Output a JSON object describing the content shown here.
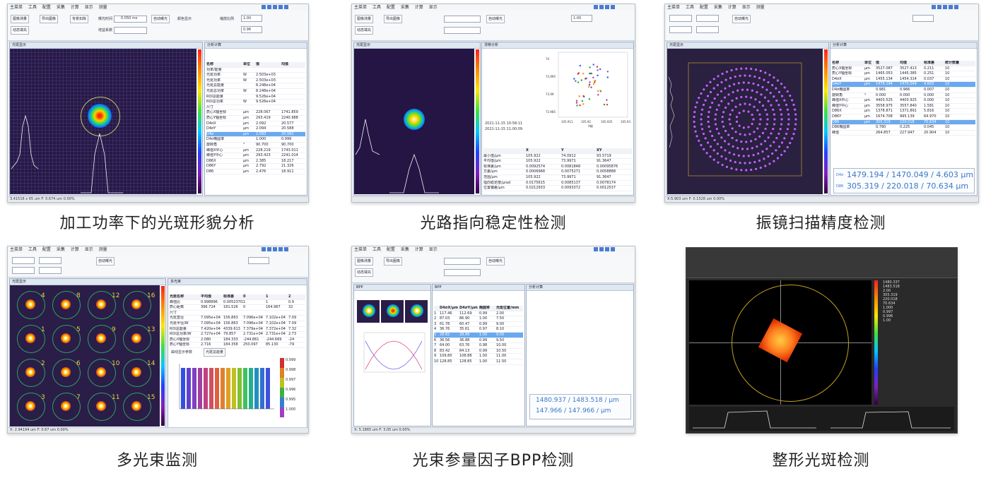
{
  "captions": {
    "c1": "加工功率下的光斑形貌分析",
    "c2": "光路指向稳定性检测",
    "c3": "振镜扫描精度检测",
    "c4": "多光束监测",
    "c5": "光束参量因子BPP检测",
    "c6": "整形光斑检测"
  },
  "menu": [
    "主菜单",
    "工具",
    "配置",
    "采集",
    "计算",
    "显示",
    "测量"
  ],
  "panel_titles": {
    "beam_display": "光斑显示",
    "analysis": "分析计算",
    "multi": "多光束",
    "bpp": "BPP",
    "drift": "漂移分析",
    "result": "结果显示"
  },
  "ribbon": {
    "image_measure": "图像测量",
    "dynamic_fill": "动态填充",
    "export_image": "导出图像",
    "auto_exposure": "自动曝光",
    "exposure_label": "曝光时间",
    "exposure_value": "0.050 ms",
    "gain_label": "增益系数",
    "gain_value": "0",
    "background": "背景扣除",
    "target_color": "颜色显示",
    "view_3d": "3D显示",
    "zoom_label": "缩放比例",
    "zoom_value": "1.00",
    "zoom_2": "0.96"
  },
  "tile1": {
    "stats_header": [
      "名称",
      "单位",
      "值",
      "均值"
    ],
    "rows": [
      [
        "功率/能量",
        "",
        "",
        ""
      ],
      [
        "光斑功率",
        "W",
        "2.503e+03",
        ""
      ],
      [
        "光斑功率",
        "W",
        "2.503e+03",
        ""
      ],
      [
        "光斑总能量",
        "",
        "8.248e+04",
        ""
      ],
      [
        "光斑总功率",
        "W",
        "8.248e+04",
        ""
      ],
      [
        "ROI总能量",
        "",
        "9.526e+04",
        ""
      ],
      [
        "ROI总功率",
        "W",
        "9.526e+04",
        ""
      ],
      [
        "尺寸",
        "",
        "",
        ""
      ],
      [
        "质心X轴坐标",
        "μm",
        "228.067",
        "1741.859"
      ],
      [
        "质心Y轴坐标",
        "μm",
        "293.419",
        "2240.988"
      ],
      [
        "D4σX",
        "μm",
        "2.092",
        "20.577"
      ],
      [
        "D4σY",
        "μm",
        "2.094",
        "20.588"
      ],
      [
        "D4σ",
        "μm",
        "2.093",
        "20.581"
      ],
      [
        "D4σ椭圆率",
        "",
        "1.000",
        "0.999"
      ],
      [
        "旋转角",
        "°",
        "90.700",
        "90.700"
      ],
      [
        "峰值X中心",
        "μm",
        "228.219",
        "1743.011"
      ],
      [
        "峰值Y中心",
        "μm",
        "293.423",
        "2241.014"
      ],
      [
        "D86X",
        "μm",
        "2.385",
        "18.217"
      ],
      [
        "D86Y",
        "μm",
        "2.792",
        "21.326"
      ],
      [
        "D86",
        "μm",
        "2.476",
        "18.911"
      ]
    ],
    "selected_row": 12,
    "status": "3.41516 x 65 um F: 0.674 um  0.00%"
  },
  "tile2": {
    "table_header": [
      "",
      "X",
      "Y",
      "XY"
    ],
    "rows": [
      [
        "最小值/μm",
        "105.922",
        "74.0912",
        "93.5719"
      ],
      [
        "平均值/μm",
        "105.922",
        "73.9971",
        "91.3647"
      ],
      [
        "标准差/μm",
        "0.0092574",
        "0.0081848",
        "0.00095876"
      ],
      [
        "方差/μm",
        "0.0006968",
        "0.0075271",
        "0.0058888"
      ],
      [
        "范围/μm",
        "105.922",
        "73.9971",
        "91.3647"
      ],
      [
        "指向稳定度/μrad",
        "0.0175615",
        "0.0085137",
        "0.0078174"
      ],
      [
        "位置偏差/μm",
        "0.0212933",
        "0.0093372",
        "0.0012537"
      ]
    ],
    "plot_xlabel": "X轴",
    "plot_ylabel": "Y轴",
    "xticks": [
      "105.911",
      "105.92",
      "105.925",
      "105.93"
    ],
    "yticks": [
      "73.985",
      "73.99",
      "73.995",
      "74"
    ],
    "time_start": "2021-11-15 10:58:11",
    "time_end": "2021-11-15 11:00:09"
  },
  "tile3": {
    "header": [
      "名称",
      "单位",
      "值",
      "均值",
      "标准差",
      "统计数量"
    ],
    "rows": [
      [
        "质心X轴坐标",
        "μm",
        "3527.087",
        "3527.413",
        "0.211",
        "10"
      ],
      [
        "质心Y轴坐标",
        "μm",
        "1465.053",
        "1445.385",
        "0.251",
        "10"
      ],
      [
        "D4σX",
        "μm",
        "1455.134",
        "1454.314",
        "0.037",
        "10"
      ],
      [
        "D4σY",
        "μm",
        "1479.194",
        "1470.049",
        "4.603",
        "10"
      ],
      [
        "D4σ椭圆率",
        "",
        "0.981",
        "0.966",
        "0.007",
        "10"
      ],
      [
        "旋转角",
        "°",
        "0.000",
        "0.000",
        "0.000",
        "10"
      ],
      [
        "峰值X中心",
        "μm",
        "4403.525",
        "4403.925",
        "0.000",
        "10"
      ],
      [
        "峰值Y中心",
        "μm",
        "3558.975",
        "3557.840",
        "1.581",
        "10"
      ],
      [
        "D86X",
        "μm",
        "1378.871",
        "1371.891",
        "5.816",
        "10"
      ],
      [
        "D86Y",
        "μm",
        "1674.708",
        "995.139",
        "64.970",
        "10"
      ],
      [
        "D86",
        "μm",
        "305.319",
        "220.018",
        "70.634",
        "10"
      ],
      [
        "D86椭圆率",
        "",
        "0.780",
        "0.225",
        "0.045",
        "10"
      ],
      [
        "峰值",
        "",
        "264.857",
        "227.947",
        "20.904",
        "10"
      ]
    ],
    "selected_rows": [
      3,
      10
    ],
    "big1": "1479.194 / 1470.049 / 4.603 μm",
    "big2": "305.319 / 220.018 / 70.634 μm",
    "big1_label": "D4σ",
    "big2_label": "D86",
    "status": "X:5.903 um F: 0.1528 um  0.00%"
  },
  "tile4": {
    "header": [
      "光斑名称",
      "平均值",
      "标准差",
      "0",
      "1",
      "2"
    ],
    "rows": [
      [
        "峰值比",
        "0.998896",
        "0.00523702",
        "1",
        "1",
        "0.9"
      ],
      [
        "质心距离",
        "396.724",
        "181.526",
        "0",
        "164.967",
        "32"
      ],
      [
        "尺寸",
        "",
        "",
        "",
        "",
        ""
      ],
      [
        "光斑直径",
        "7.095e+04",
        "156.863",
        "7.096e+04",
        "7.102e+04",
        "7.09"
      ],
      [
        "光斑半径/W",
        "7.095e+04",
        "156.863",
        "7.096e+04",
        "7.102e+04",
        "7.09"
      ],
      [
        "ROI总能量",
        "7.420e+04",
        "4339.613",
        "7.379e+04",
        "7.372e+04",
        "7.32"
      ],
      [
        "ROI总功率/W",
        "2.727e+04",
        "79.857",
        "2.731e+04",
        "2.731e+04",
        "2.73"
      ],
      [
        "质心X轴坐标",
        "2.080",
        "184.333",
        "-244.861",
        "-244.669",
        "-24"
      ],
      [
        "质心Y轴坐标",
        "2.716",
        "184.358",
        "250.097",
        "85.130",
        "-79"
      ]
    ],
    "spot_labels": [
      "4",
      "8",
      "12",
      "16",
      "1",
      "5",
      "9",
      "13",
      "2",
      "6",
      "10",
      "14",
      "3",
      "7",
      "11",
      "15"
    ],
    "chart_title": "曲线显示参数",
    "chart_button": "光斑总能量",
    "legend_values": [
      "0.999",
      "0.998",
      "0.997",
      "0.996",
      "0.995",
      "1.000"
    ],
    "status": "X: 2.94194 um F: 0.67 um  0.00%"
  },
  "tile5": {
    "header": [
      "",
      "D4σX/μm",
      "D4σY/μm",
      "椭圆率",
      "光斑位置/mm"
    ],
    "rows": [
      [
        "1",
        "117.46",
        "112.69",
        "0.99",
        "2.00"
      ],
      [
        "2",
        "87.03",
        "86.90",
        "1.00",
        "7.50"
      ],
      [
        "3",
        "61.78",
        "60.47",
        "0.99",
        "9.00"
      ],
      [
        "4",
        "36.76",
        "35.61",
        "0.97",
        "8.10"
      ],
      [
        "5",
        "28.82",
        "28.89",
        "1.00",
        "9.00"
      ],
      [
        "6",
        "36.56",
        "36.88",
        "0.99",
        "9.50"
      ],
      [
        "7",
        "64.00",
        "63.76",
        "0.98",
        "10.00"
      ],
      [
        "8",
        "83.42",
        "84.13",
        "0.99",
        "10.50"
      ],
      [
        "9",
        "109.80",
        "108.88",
        "1.00",
        "11.00"
      ],
      [
        "10",
        "128.85",
        "128.85",
        "1.00",
        "11.50"
      ]
    ],
    "big1": "1480.937 / 1483.518 / μm",
    "big2": "147.966 / 147.966 / μm",
    "status": "X: 5.1865 um F: 3.05 um  0.00%"
  },
  "tile6": {
    "values": [
      "1480.337",
      "1483.518",
      "2.00",
      "305.319",
      "220.018",
      "70.634",
      "1.000",
      "0.997",
      "0.996",
      "1.00"
    ],
    "status": "1923.03 um"
  }
}
